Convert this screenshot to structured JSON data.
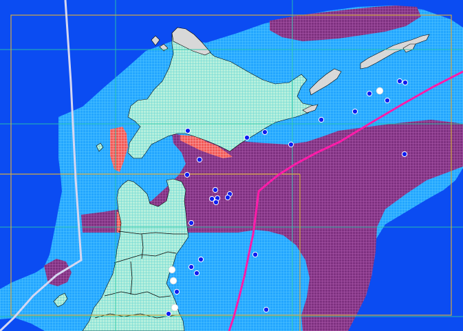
{
  "colors": {
    "ocean": "#0b4cf2",
    "ocean_grid": "#23a6ff",
    "ocean_grid_light": "#56c7ff",
    "land": "#b7f0dd",
    "land_grid": "#66d4d2",
    "purple_zone": "#7e3180",
    "purple_grid": "#b45fb2",
    "red_zone": "#f05a57",
    "red_grid": "#ffb3b3",
    "gray_land": "#d8d8d8",
    "border": "#000000",
    "frame": "#d4aa43",
    "graticule": "#29c7a7",
    "route_light": "#d5d7f1",
    "route_pink": "#ff1ca8",
    "marker_blue": "#0e1df0",
    "marker_white": "#ffffff"
  },
  "map": {
    "legend_absent": true
  }
}
